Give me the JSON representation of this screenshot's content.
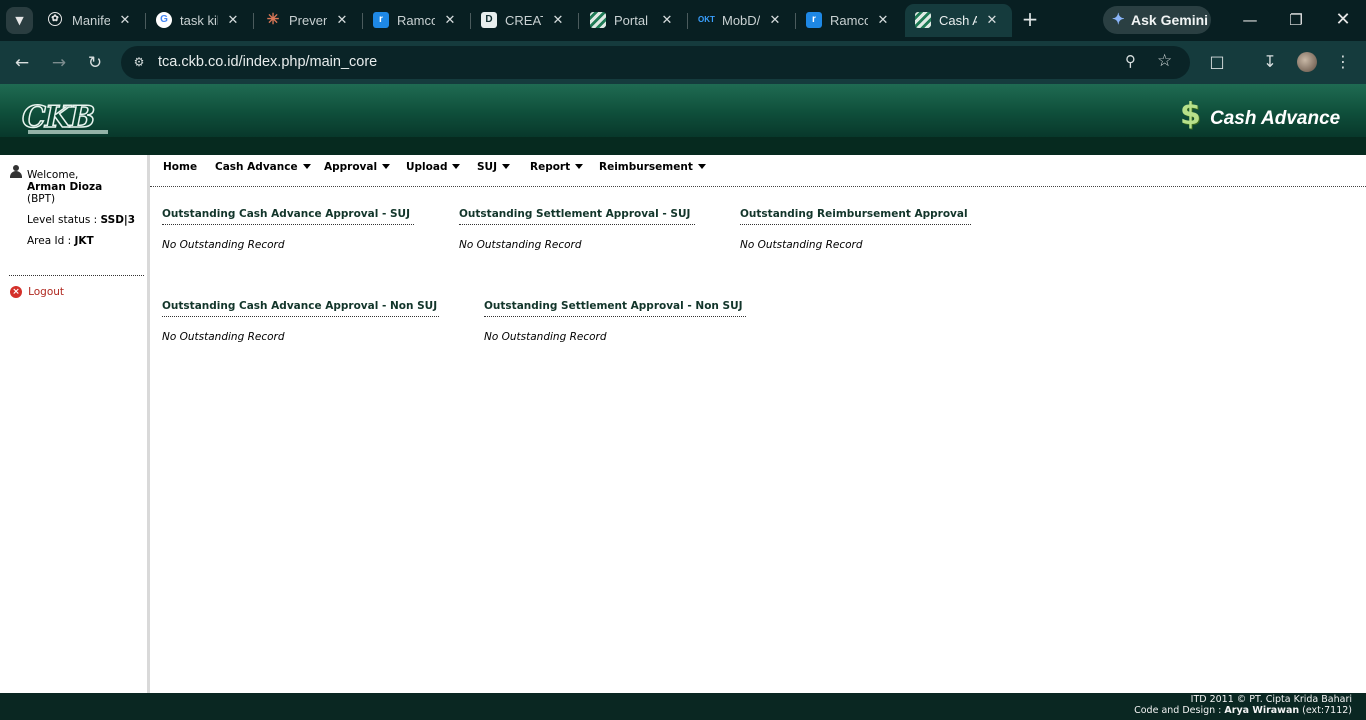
{
  "browser": {
    "tabs": [
      {
        "title": "Manife",
        "icon": "openai-icon"
      },
      {
        "title": "task kil",
        "icon": "google-icon"
      },
      {
        "title": "Preven",
        "icon": "claude-icon"
      },
      {
        "title": "Ramco",
        "icon": "ramco-icon"
      },
      {
        "title": "CREATI",
        "icon": "d-icon"
      },
      {
        "title": "Portal",
        "icon": "stripes-icon"
      },
      {
        "title": "MobD/",
        "icon": "mob-icon"
      },
      {
        "title": "Ramco",
        "icon": "ramco-icon"
      },
      {
        "title": "Cash A",
        "icon": "stripes-icon"
      }
    ],
    "active_tab_index": 8,
    "ask_gemini_label": "Ask Gemini",
    "url": "tca.ckb.co.id/index.php/main_core"
  },
  "header": {
    "logo_text": "CKB",
    "brand_symbol": "$",
    "app_title": "Cash Advance"
  },
  "sidebar": {
    "welcome": "Welcome,",
    "user_name": "Arman Dioza",
    "user_unit": "(BPT)",
    "level_label": "Level status :",
    "level_value": "SSD|3",
    "area_label": "Area Id :",
    "area_value": "JKT",
    "logout_label": "Logout"
  },
  "menu": {
    "items": [
      {
        "label": "Home",
        "dropdown": false
      },
      {
        "label": "Cash Advance",
        "dropdown": true
      },
      {
        "label": "Approval",
        "dropdown": true
      },
      {
        "label": "Upload",
        "dropdown": true
      },
      {
        "label": "SUJ",
        "dropdown": true
      },
      {
        "label": "Report",
        "dropdown": true
      },
      {
        "label": "Reimbursement",
        "dropdown": true
      }
    ]
  },
  "panels": [
    {
      "title": "Outstanding Cash Advance Approval - SUJ",
      "empty_text": "No Outstanding Record"
    },
    {
      "title": "Outstanding Settlement Approval - SUJ",
      "empty_text": "No Outstanding Record"
    },
    {
      "title": "Outstanding Reimbursement Approval",
      "empty_text": "No Outstanding Record"
    },
    {
      "title": "Outstanding Cash Advance Approval - Non SUJ",
      "empty_text": "No Outstanding Record"
    },
    {
      "title": "Outstanding Settlement Approval - Non SUJ",
      "empty_text": "No Outstanding Record"
    }
  ],
  "footer": {
    "line1": "ITD 2011 © PT. Cipta Krida Bahari",
    "line2_prefix": "Code and Design :",
    "line2_name": "Arya Wirawan",
    "line2_suffix": "(ext:7112)"
  },
  "colors": {
    "browser_frame": "#081f22",
    "header_green": "#0f4f3b",
    "footer_green": "#0a2722",
    "logout_red": "#d4302a"
  }
}
